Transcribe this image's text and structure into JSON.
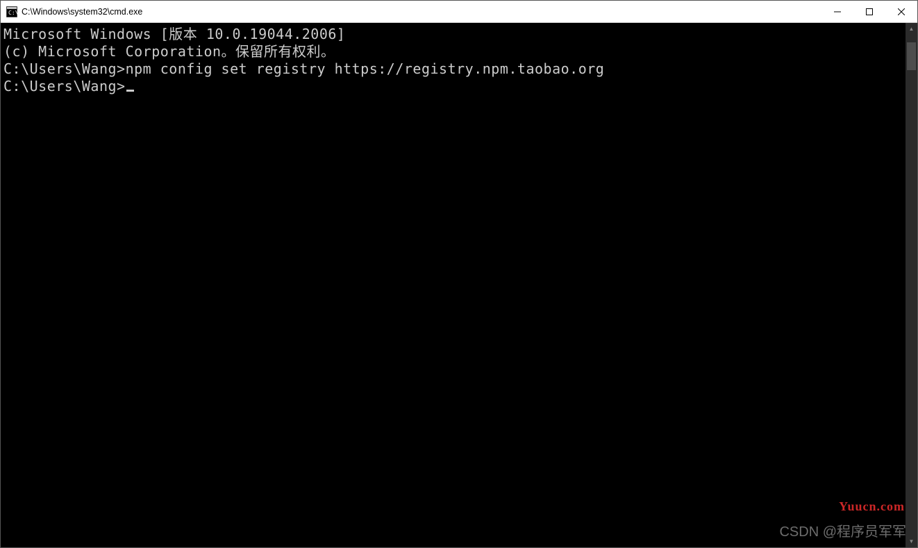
{
  "window": {
    "title": "C:\\Windows\\system32\\cmd.exe"
  },
  "terminal": {
    "header_line": "Microsoft Windows [版本 10.0.19044.2006]",
    "copyright_line": "(c) Microsoft Corporation。保留所有权利。",
    "blank1": "",
    "prompt1_path": "C:\\Users\\Wang>",
    "prompt1_command": "npm config set registry https://registry.npm.taobao.org",
    "blank2": "",
    "prompt2_path": "C:\\Users\\Wang>"
  },
  "watermarks": {
    "red": "Yuucn.com",
    "gray": "CSDN @程序员军军"
  }
}
